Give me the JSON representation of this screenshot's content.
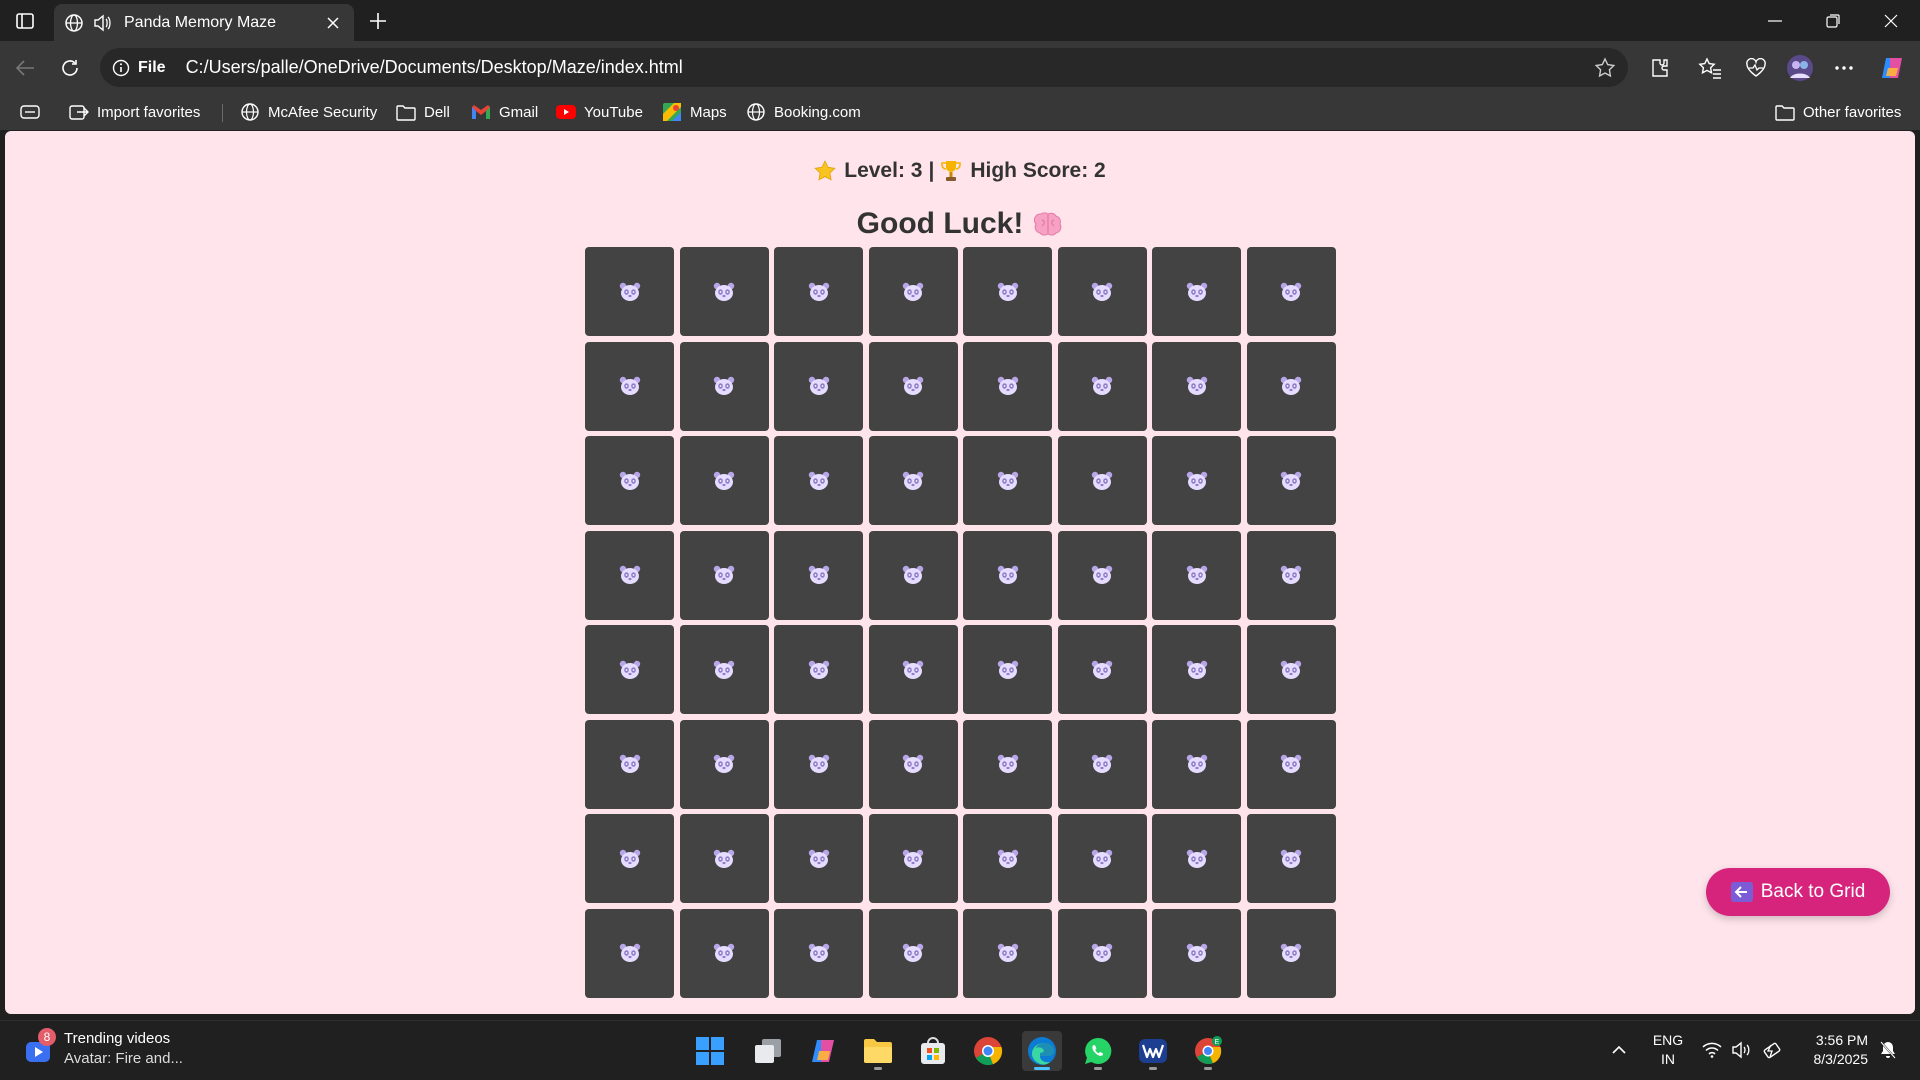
{
  "browser": {
    "tab": {
      "title": "Panda Memory Maze"
    },
    "address": {
      "chip": "File",
      "url": "C:/Users/palle/OneDrive/Documents/Desktop/Maze/index.html"
    },
    "favorites": [
      {
        "label": "Import favorites",
        "icon": "import-icon"
      },
      {
        "label": "McAfee Security",
        "icon": "globe-icon"
      },
      {
        "label": "Dell",
        "icon": "folder-icon"
      },
      {
        "label": "Gmail",
        "icon": "gmail-icon"
      },
      {
        "label": "YouTube",
        "icon": "youtube-icon"
      },
      {
        "label": "Maps",
        "icon": "maps-icon"
      },
      {
        "label": "Booking.com",
        "icon": "globe-icon"
      }
    ],
    "other_favorites": "Other favorites"
  },
  "game": {
    "level_label": "Level: 3",
    "separator": "|",
    "high_score_label": "High Score: 2",
    "status": "Good Luck!",
    "grid": {
      "rows": 8,
      "cols": 8,
      "tile_icon": "panda-icon"
    },
    "back_button": "Back to Grid"
  },
  "taskbar": {
    "widget": {
      "badge": "8",
      "title": "Trending videos",
      "subtitle": "Avatar: Fire and..."
    },
    "apps": [
      "start",
      "task-view",
      "copilot",
      "file-explorer",
      "microsoft-store",
      "chrome",
      "edge",
      "whatsapp",
      "webex",
      "chrome-profile"
    ],
    "language": {
      "line1": "ENG",
      "line2": "IN"
    },
    "clock": {
      "time": "3:56 PM",
      "date": "8/3/2025"
    }
  },
  "colors": {
    "page_background": "#ffe4ec",
    "tile": "#434343",
    "accent_button": "#d6247d",
    "browser_chrome": "#373737"
  }
}
